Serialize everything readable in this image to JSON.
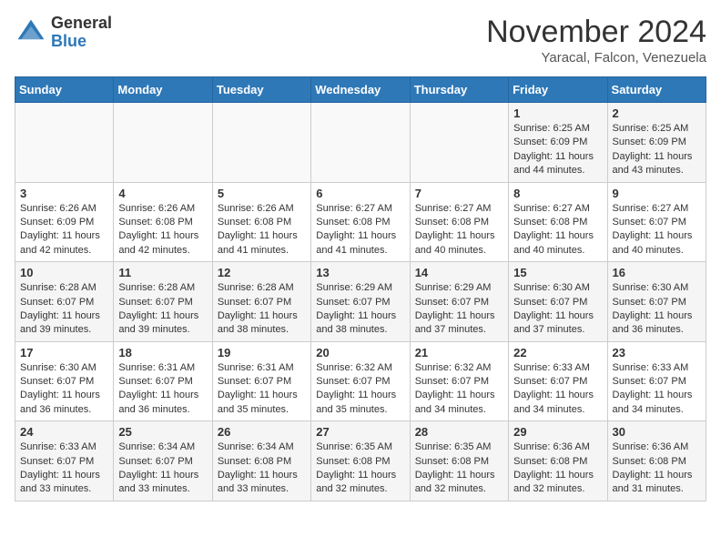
{
  "header": {
    "logo_general": "General",
    "logo_blue": "Blue",
    "month_title": "November 2024",
    "location": "Yaracal, Falcon, Venezuela"
  },
  "days_of_week": [
    "Sunday",
    "Monday",
    "Tuesday",
    "Wednesday",
    "Thursday",
    "Friday",
    "Saturday"
  ],
  "weeks": [
    [
      {
        "day": "",
        "info": ""
      },
      {
        "day": "",
        "info": ""
      },
      {
        "day": "",
        "info": ""
      },
      {
        "day": "",
        "info": ""
      },
      {
        "day": "",
        "info": ""
      },
      {
        "day": "1",
        "info": "Sunrise: 6:25 AM\nSunset: 6:09 PM\nDaylight: 11 hours and 44 minutes."
      },
      {
        "day": "2",
        "info": "Sunrise: 6:25 AM\nSunset: 6:09 PM\nDaylight: 11 hours and 43 minutes."
      }
    ],
    [
      {
        "day": "3",
        "info": "Sunrise: 6:26 AM\nSunset: 6:09 PM\nDaylight: 11 hours and 42 minutes."
      },
      {
        "day": "4",
        "info": "Sunrise: 6:26 AM\nSunset: 6:08 PM\nDaylight: 11 hours and 42 minutes."
      },
      {
        "day": "5",
        "info": "Sunrise: 6:26 AM\nSunset: 6:08 PM\nDaylight: 11 hours and 41 minutes."
      },
      {
        "day": "6",
        "info": "Sunrise: 6:27 AM\nSunset: 6:08 PM\nDaylight: 11 hours and 41 minutes."
      },
      {
        "day": "7",
        "info": "Sunrise: 6:27 AM\nSunset: 6:08 PM\nDaylight: 11 hours and 40 minutes."
      },
      {
        "day": "8",
        "info": "Sunrise: 6:27 AM\nSunset: 6:08 PM\nDaylight: 11 hours and 40 minutes."
      },
      {
        "day": "9",
        "info": "Sunrise: 6:27 AM\nSunset: 6:07 PM\nDaylight: 11 hours and 40 minutes."
      }
    ],
    [
      {
        "day": "10",
        "info": "Sunrise: 6:28 AM\nSunset: 6:07 PM\nDaylight: 11 hours and 39 minutes."
      },
      {
        "day": "11",
        "info": "Sunrise: 6:28 AM\nSunset: 6:07 PM\nDaylight: 11 hours and 39 minutes."
      },
      {
        "day": "12",
        "info": "Sunrise: 6:28 AM\nSunset: 6:07 PM\nDaylight: 11 hours and 38 minutes."
      },
      {
        "day": "13",
        "info": "Sunrise: 6:29 AM\nSunset: 6:07 PM\nDaylight: 11 hours and 38 minutes."
      },
      {
        "day": "14",
        "info": "Sunrise: 6:29 AM\nSunset: 6:07 PM\nDaylight: 11 hours and 37 minutes."
      },
      {
        "day": "15",
        "info": "Sunrise: 6:30 AM\nSunset: 6:07 PM\nDaylight: 11 hours and 37 minutes."
      },
      {
        "day": "16",
        "info": "Sunrise: 6:30 AM\nSunset: 6:07 PM\nDaylight: 11 hours and 36 minutes."
      }
    ],
    [
      {
        "day": "17",
        "info": "Sunrise: 6:30 AM\nSunset: 6:07 PM\nDaylight: 11 hours and 36 minutes."
      },
      {
        "day": "18",
        "info": "Sunrise: 6:31 AM\nSunset: 6:07 PM\nDaylight: 11 hours and 36 minutes."
      },
      {
        "day": "19",
        "info": "Sunrise: 6:31 AM\nSunset: 6:07 PM\nDaylight: 11 hours and 35 minutes."
      },
      {
        "day": "20",
        "info": "Sunrise: 6:32 AM\nSunset: 6:07 PM\nDaylight: 11 hours and 35 minutes."
      },
      {
        "day": "21",
        "info": "Sunrise: 6:32 AM\nSunset: 6:07 PM\nDaylight: 11 hours and 34 minutes."
      },
      {
        "day": "22",
        "info": "Sunrise: 6:33 AM\nSunset: 6:07 PM\nDaylight: 11 hours and 34 minutes."
      },
      {
        "day": "23",
        "info": "Sunrise: 6:33 AM\nSunset: 6:07 PM\nDaylight: 11 hours and 34 minutes."
      }
    ],
    [
      {
        "day": "24",
        "info": "Sunrise: 6:33 AM\nSunset: 6:07 PM\nDaylight: 11 hours and 33 minutes."
      },
      {
        "day": "25",
        "info": "Sunrise: 6:34 AM\nSunset: 6:07 PM\nDaylight: 11 hours and 33 minutes."
      },
      {
        "day": "26",
        "info": "Sunrise: 6:34 AM\nSunset: 6:08 PM\nDaylight: 11 hours and 33 minutes."
      },
      {
        "day": "27",
        "info": "Sunrise: 6:35 AM\nSunset: 6:08 PM\nDaylight: 11 hours and 32 minutes."
      },
      {
        "day": "28",
        "info": "Sunrise: 6:35 AM\nSunset: 6:08 PM\nDaylight: 11 hours and 32 minutes."
      },
      {
        "day": "29",
        "info": "Sunrise: 6:36 AM\nSunset: 6:08 PM\nDaylight: 11 hours and 32 minutes."
      },
      {
        "day": "30",
        "info": "Sunrise: 6:36 AM\nSunset: 6:08 PM\nDaylight: 11 hours and 31 minutes."
      }
    ]
  ]
}
